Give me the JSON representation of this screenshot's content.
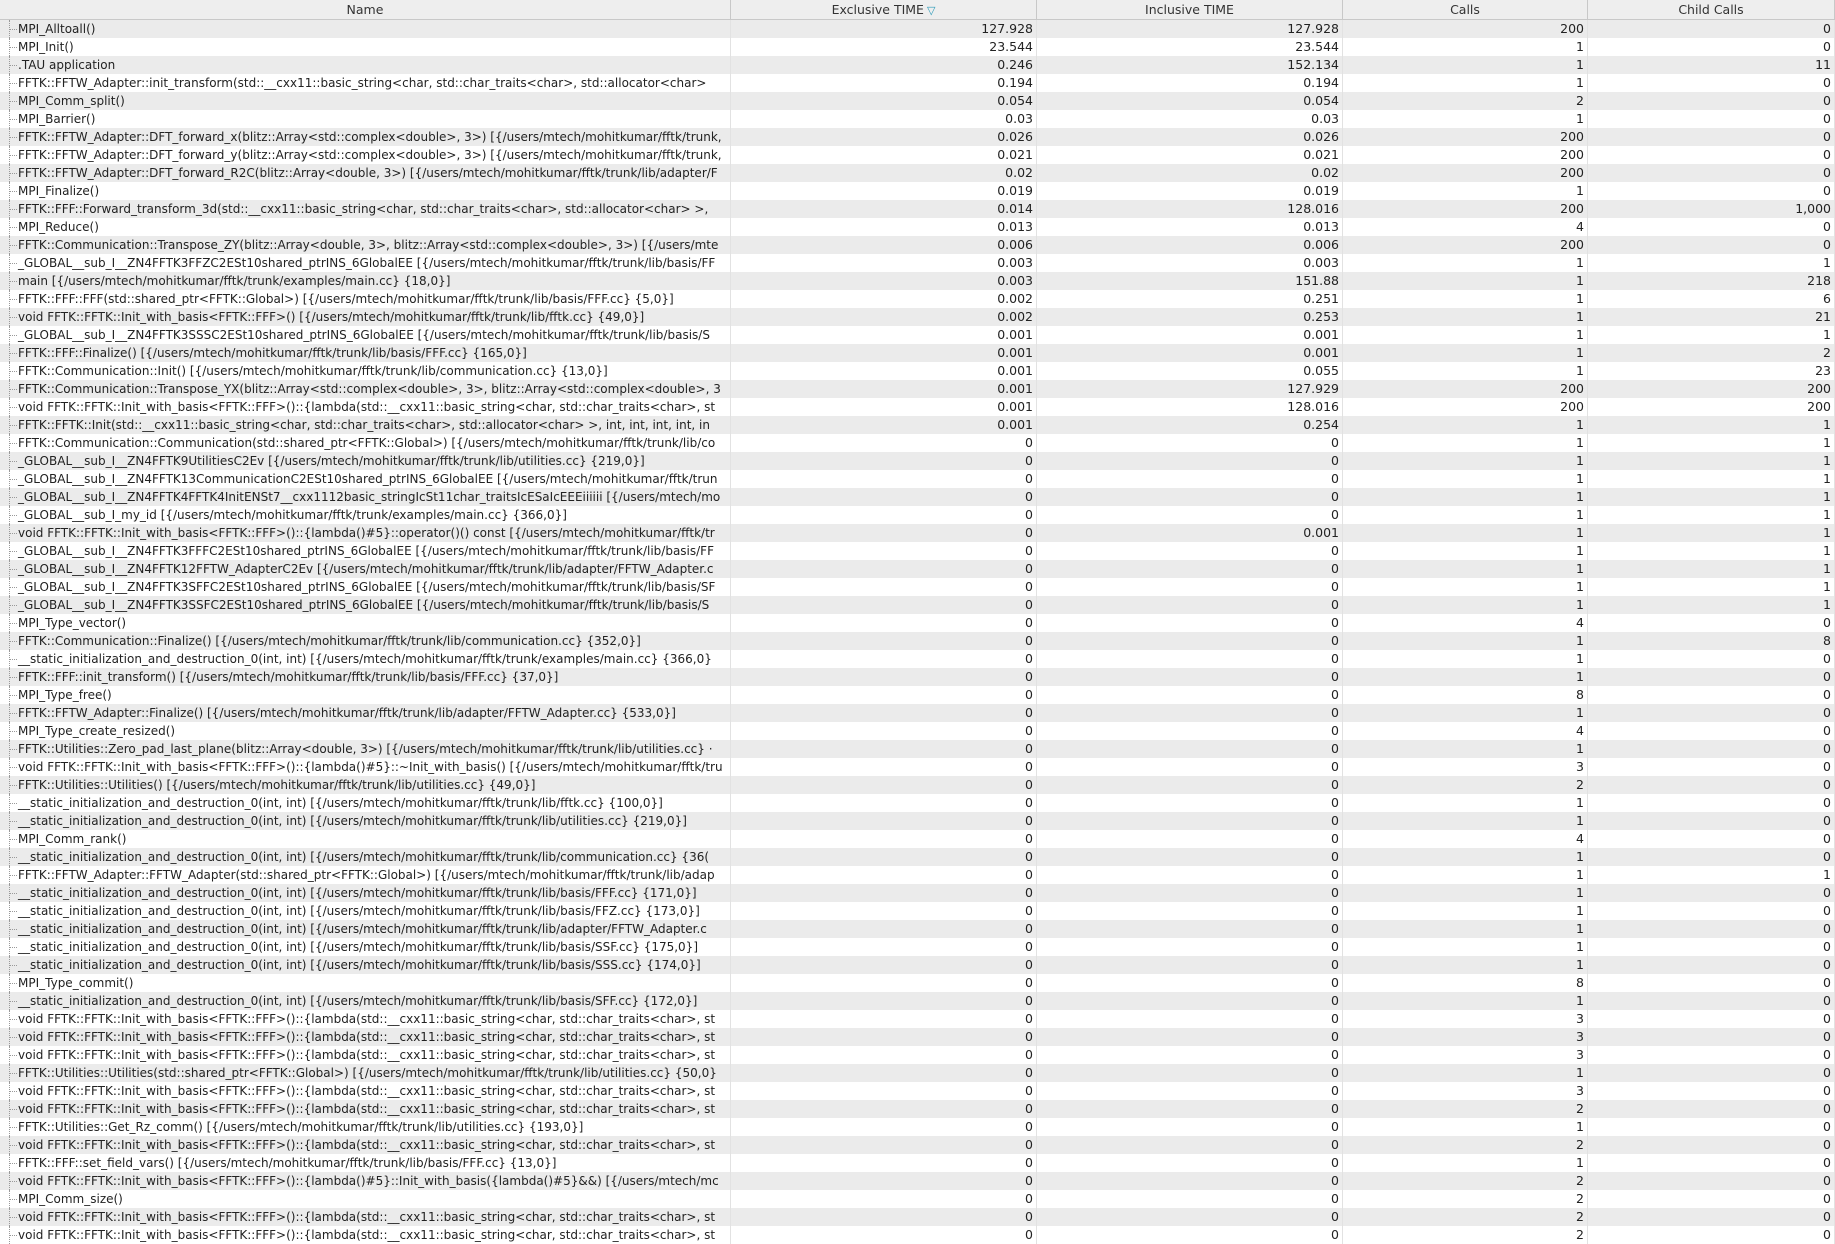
{
  "columns": [
    "Name",
    "Exclusive TIME",
    "Inclusive TIME",
    "Calls",
    "Child Calls"
  ],
  "sort_indicator": "▽",
  "rows": [
    [
      "MPI_Alltoall()",
      "127.928",
      "127.928",
      "200",
      "0"
    ],
    [
      "MPI_Init()",
      "23.544",
      "23.544",
      "1",
      "0"
    ],
    [
      ".TAU application",
      "0.246",
      "152.134",
      "1",
      "11"
    ],
    [
      "FFTK::FFTW_Adapter::init_transform(std::__cxx11::basic_string<char, std::char_traits<char>, std::allocator<char>",
      "0.194",
      "0.194",
      "1",
      "0"
    ],
    [
      "MPI_Comm_split()",
      "0.054",
      "0.054",
      "2",
      "0"
    ],
    [
      "MPI_Barrier()",
      "0.03",
      "0.03",
      "1",
      "0"
    ],
    [
      "FFTK::FFTW_Adapter::DFT_forward_x(blitz::Array<std::complex<double>, 3>) [{/users/mtech/mohitkumar/fftk/trunk,",
      "0.026",
      "0.026",
      "200",
      "0"
    ],
    [
      "FFTK::FFTW_Adapter::DFT_forward_y(blitz::Array<std::complex<double>, 3>) [{/users/mtech/mohitkumar/fftk/trunk,",
      "0.021",
      "0.021",
      "200",
      "0"
    ],
    [
      "FFTK::FFTW_Adapter::DFT_forward_R2C(blitz::Array<double, 3>) [{/users/mtech/mohitkumar/fftk/trunk/lib/adapter/F",
      "0.02",
      "0.02",
      "200",
      "0"
    ],
    [
      "MPI_Finalize()",
      "0.019",
      "0.019",
      "1",
      "0"
    ],
    [
      "FFTK::FFF::Forward_transform_3d(std::__cxx11::basic_string<char, std::char_traits<char>, std::allocator<char> >,",
      "0.014",
      "128.016",
      "200",
      "1,000"
    ],
    [
      "MPI_Reduce()",
      "0.013",
      "0.013",
      "4",
      "0"
    ],
    [
      "FFTK::Communication::Transpose_ZY(blitz::Array<double, 3>, blitz::Array<std::complex<double>, 3>) [{/users/mte",
      "0.006",
      "0.006",
      "200",
      "0"
    ],
    [
      "_GLOBAL__sub_I__ZN4FFTK3FFZC2ESt10shared_ptrINS_6GlobalEE [{/users/mtech/mohitkumar/fftk/trunk/lib/basis/FF",
      "0.003",
      "0.003",
      "1",
      "1"
    ],
    [
      "main [{/users/mtech/mohitkumar/fftk/trunk/examples/main.cc} {18,0}]",
      "0.003",
      "151.88",
      "1",
      "218"
    ],
    [
      "FFTK::FFF::FFF(std::shared_ptr<FFTK::Global>) [{/users/mtech/mohitkumar/fftk/trunk/lib/basis/FFF.cc} {5,0}]",
      "0.002",
      "0.251",
      "1",
      "6"
    ],
    [
      "void FFTK::FFTK::Init_with_basis<FFTK::FFF>() [{/users/mtech/mohitkumar/fftk/trunk/lib/fftk.cc} {49,0}]",
      "0.002",
      "0.253",
      "1",
      "21"
    ],
    [
      "_GLOBAL__sub_I__ZN4FFTK3SSSC2ESt10shared_ptrINS_6GlobalEE [{/users/mtech/mohitkumar/fftk/trunk/lib/basis/S",
      "0.001",
      "0.001",
      "1",
      "1"
    ],
    [
      "FFTK::FFF::Finalize() [{/users/mtech/mohitkumar/fftk/trunk/lib/basis/FFF.cc} {165,0}]",
      "0.001",
      "0.001",
      "1",
      "2"
    ],
    [
      "FFTK::Communication::Init() [{/users/mtech/mohitkumar/fftk/trunk/lib/communication.cc} {13,0}]",
      "0.001",
      "0.055",
      "1",
      "23"
    ],
    [
      "FFTK::Communication::Transpose_YX(blitz::Array<std::complex<double>, 3>, blitz::Array<std::complex<double>, 3",
      "0.001",
      "127.929",
      "200",
      "200"
    ],
    [
      "void FFTK::FFTK::Init_with_basis<FFTK::FFF>()::{lambda(std::__cxx11::basic_string<char, std::char_traits<char>, st",
      "0.001",
      "128.016",
      "200",
      "200"
    ],
    [
      "FFTK::FFTK::Init(std::__cxx11::basic_string<char, std::char_traits<char>, std::allocator<char> >, int, int, int, int, in",
      "0.001",
      "0.254",
      "1",
      "1"
    ],
    [
      "FFTK::Communication::Communication(std::shared_ptr<FFTK::Global>) [{/users/mtech/mohitkumar/fftk/trunk/lib/co",
      "0",
      "0",
      "1",
      "1"
    ],
    [
      "_GLOBAL__sub_I__ZN4FFTK9UtilitiesC2Ev [{/users/mtech/mohitkumar/fftk/trunk/lib/utilities.cc} {219,0}]",
      "0",
      "0",
      "1",
      "1"
    ],
    [
      "_GLOBAL__sub_I__ZN4FFTK13CommunicationC2ESt10shared_ptrINS_6GlobalEE [{/users/mtech/mohitkumar/fftk/trun",
      "0",
      "0",
      "1",
      "1"
    ],
    [
      "_GLOBAL__sub_I__ZN4FFTK4FFTK4InitENSt7__cxx1112basic_stringIcSt11char_traitsIcESaIcEEEiiiiii [{/users/mtech/mo",
      "0",
      "0",
      "1",
      "1"
    ],
    [
      "_GLOBAL__sub_I_my_id [{/users/mtech/mohitkumar/fftk/trunk/examples/main.cc} {366,0}]",
      "0",
      "0",
      "1",
      "1"
    ],
    [
      "void FFTK::FFTK::Init_with_basis<FFTK::FFF>()::{lambda()#5}::operator()() const [{/users/mtech/mohitkumar/fftk/tr",
      "0",
      "0.001",
      "1",
      "1"
    ],
    [
      "_GLOBAL__sub_I__ZN4FFTK3FFFC2ESt10shared_ptrINS_6GlobalEE [{/users/mtech/mohitkumar/fftk/trunk/lib/basis/FF",
      "0",
      "0",
      "1",
      "1"
    ],
    [
      "_GLOBAL__sub_I__ZN4FFTK12FFTW_AdapterC2Ev [{/users/mtech/mohitkumar/fftk/trunk/lib/adapter/FFTW_Adapter.c",
      "0",
      "0",
      "1",
      "1"
    ],
    [
      "_GLOBAL__sub_I__ZN4FFTK3SFFC2ESt10shared_ptrINS_6GlobalEE [{/users/mtech/mohitkumar/fftk/trunk/lib/basis/SF",
      "0",
      "0",
      "1",
      "1"
    ],
    [
      "_GLOBAL__sub_I__ZN4FFTK3SSFC2ESt10shared_ptrINS_6GlobalEE [{/users/mtech/mohitkumar/fftk/trunk/lib/basis/S",
      "0",
      "0",
      "1",
      "1"
    ],
    [
      "MPI_Type_vector()",
      "0",
      "0",
      "4",
      "0"
    ],
    [
      "FFTK::Communication::Finalize() [{/users/mtech/mohitkumar/fftk/trunk/lib/communication.cc} {352,0}]",
      "0",
      "0",
      "1",
      "8"
    ],
    [
      "__static_initialization_and_destruction_0(int, int) [{/users/mtech/mohitkumar/fftk/trunk/examples/main.cc} {366,0}",
      "0",
      "0",
      "1",
      "0"
    ],
    [
      "FFTK::FFF::init_transform() [{/users/mtech/mohitkumar/fftk/trunk/lib/basis/FFF.cc} {37,0}]",
      "0",
      "0",
      "1",
      "0"
    ],
    [
      "MPI_Type_free()",
      "0",
      "0",
      "8",
      "0"
    ],
    [
      "FFTK::FFTW_Adapter::Finalize() [{/users/mtech/mohitkumar/fftk/trunk/lib/adapter/FFTW_Adapter.cc} {533,0}]",
      "0",
      "0",
      "1",
      "0"
    ],
    [
      "MPI_Type_create_resized()",
      "0",
      "0",
      "4",
      "0"
    ],
    [
      "FFTK::Utilities::Zero_pad_last_plane(blitz::Array<double, 3>) [{/users/mtech/mohitkumar/fftk/trunk/lib/utilities.cc} ·",
      "0",
      "0",
      "1",
      "0"
    ],
    [
      "void FFTK::FFTK::Init_with_basis<FFTK::FFF>()::{lambda()#5}::~Init_with_basis() [{/users/mtech/mohitkumar/fftk/tru",
      "0",
      "0",
      "3",
      "0"
    ],
    [
      "FFTK::Utilities::Utilities() [{/users/mtech/mohitkumar/fftk/trunk/lib/utilities.cc} {49,0}]",
      "0",
      "0",
      "2",
      "0"
    ],
    [
      "__static_initialization_and_destruction_0(int, int) [{/users/mtech/mohitkumar/fftk/trunk/lib/fftk.cc} {100,0}]",
      "0",
      "0",
      "1",
      "0"
    ],
    [
      "__static_initialization_and_destruction_0(int, int) [{/users/mtech/mohitkumar/fftk/trunk/lib/utilities.cc} {219,0}]",
      "0",
      "0",
      "1",
      "0"
    ],
    [
      "MPI_Comm_rank()",
      "0",
      "0",
      "4",
      "0"
    ],
    [
      "__static_initialization_and_destruction_0(int, int) [{/users/mtech/mohitkumar/fftk/trunk/lib/communication.cc} {36(",
      "0",
      "0",
      "1",
      "0"
    ],
    [
      "FFTK::FFTW_Adapter::FFTW_Adapter(std::shared_ptr<FFTK::Global>) [{/users/mtech/mohitkumar/fftk/trunk/lib/adap",
      "0",
      "0",
      "1",
      "1"
    ],
    [
      "__static_initialization_and_destruction_0(int, int) [{/users/mtech/mohitkumar/fftk/trunk/lib/basis/FFF.cc} {171,0}]",
      "0",
      "0",
      "1",
      "0"
    ],
    [
      "__static_initialization_and_destruction_0(int, int) [{/users/mtech/mohitkumar/fftk/trunk/lib/basis/FFZ.cc} {173,0}]",
      "0",
      "0",
      "1",
      "0"
    ],
    [
      "__static_initialization_and_destruction_0(int, int) [{/users/mtech/mohitkumar/fftk/trunk/lib/adapter/FFTW_Adapter.c",
      "0",
      "0",
      "1",
      "0"
    ],
    [
      "__static_initialization_and_destruction_0(int, int) [{/users/mtech/mohitkumar/fftk/trunk/lib/basis/SSF.cc} {175,0}]",
      "0",
      "0",
      "1",
      "0"
    ],
    [
      "__static_initialization_and_destruction_0(int, int) [{/users/mtech/mohitkumar/fftk/trunk/lib/basis/SSS.cc} {174,0}]",
      "0",
      "0",
      "1",
      "0"
    ],
    [
      "MPI_Type_commit()",
      "0",
      "0",
      "8",
      "0"
    ],
    [
      "__static_initialization_and_destruction_0(int, int) [{/users/mtech/mohitkumar/fftk/trunk/lib/basis/SFF.cc} {172,0}]",
      "0",
      "0",
      "1",
      "0"
    ],
    [
      "void FFTK::FFTK::Init_with_basis<FFTK::FFF>()::{lambda(std::__cxx11::basic_string<char, std::char_traits<char>, st",
      "0",
      "0",
      "3",
      "0"
    ],
    [
      "void FFTK::FFTK::Init_with_basis<FFTK::FFF>()::{lambda(std::__cxx11::basic_string<char, std::char_traits<char>, st",
      "0",
      "0",
      "3",
      "0"
    ],
    [
      "void FFTK::FFTK::Init_with_basis<FFTK::FFF>()::{lambda(std::__cxx11::basic_string<char, std::char_traits<char>, st",
      "0",
      "0",
      "3",
      "0"
    ],
    [
      "FFTK::Utilities::Utilities(std::shared_ptr<FFTK::Global>) [{/users/mtech/mohitkumar/fftk/trunk/lib/utilities.cc} {50,0}",
      "0",
      "0",
      "1",
      "0"
    ],
    [
      "void FFTK::FFTK::Init_with_basis<FFTK::FFF>()::{lambda(std::__cxx11::basic_string<char, std::char_traits<char>, st",
      "0",
      "0",
      "3",
      "0"
    ],
    [
      "void FFTK::FFTK::Init_with_basis<FFTK::FFF>()::{lambda(std::__cxx11::basic_string<char, std::char_traits<char>, st",
      "0",
      "0",
      "2",
      "0"
    ],
    [
      "FFTK::Utilities::Get_Rz_comm() [{/users/mtech/mohitkumar/fftk/trunk/lib/utilities.cc} {193,0}]",
      "0",
      "0",
      "1",
      "0"
    ],
    [
      "void FFTK::FFTK::Init_with_basis<FFTK::FFF>()::{lambda(std::__cxx11::basic_string<char, std::char_traits<char>, st",
      "0",
      "0",
      "2",
      "0"
    ],
    [
      "FFTK::FFF::set_field_vars() [{/users/mtech/mohitkumar/fftk/trunk/lib/basis/FFF.cc} {13,0}]",
      "0",
      "0",
      "1",
      "0"
    ],
    [
      "void FFTK::FFTK::Init_with_basis<FFTK::FFF>()::{lambda()#5}::Init_with_basis({lambda()#5}&&) [{/users/mtech/mc",
      "0",
      "0",
      "2",
      "0"
    ],
    [
      "MPI_Comm_size()",
      "0",
      "0",
      "2",
      "0"
    ],
    [
      "void FFTK::FFTK::Init_with_basis<FFTK::FFF>()::{lambda(std::__cxx11::basic_string<char, std::char_traits<char>, st",
      "0",
      "0",
      "2",
      "0"
    ],
    [
      "void FFTK::FFTK::Init_with_basis<FFTK::FFF>()::{lambda(std::__cxx11::basic_string<char, std::char_traits<char>, st",
      "0",
      "0",
      "2",
      "0"
    ]
  ]
}
